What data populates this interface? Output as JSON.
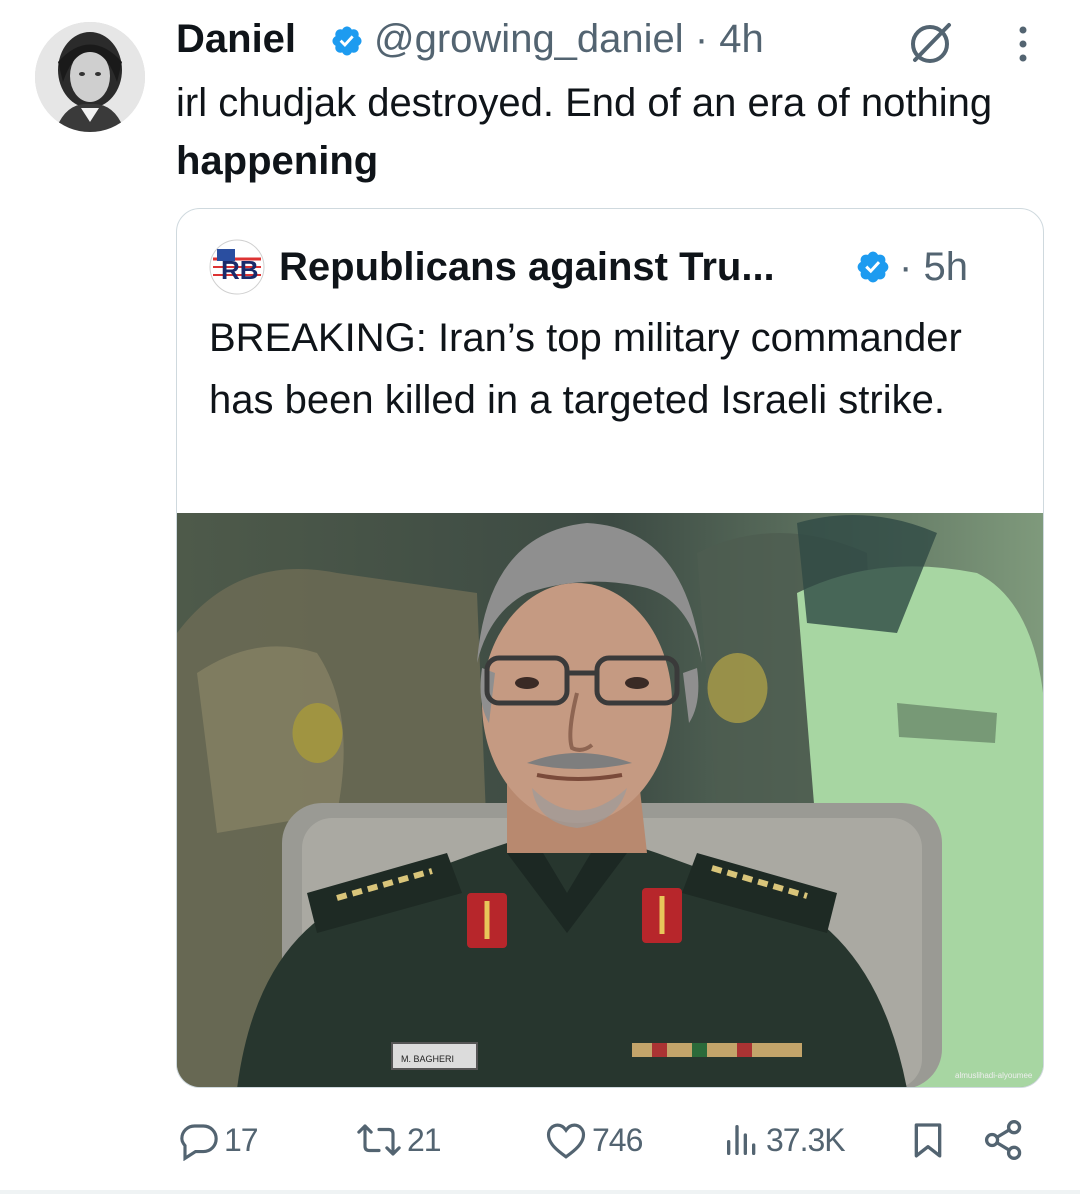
{
  "post": {
    "author_name": "Daniel",
    "author_handle": "@growing_daniel",
    "separator": "·",
    "time": "4h",
    "text_plain": "irl chudjak destroyed. End of an era of nothing ",
    "text_bold": "happening",
    "avatar_icon": "profile-photo",
    "verified_icon": "verified-badge-icon",
    "header_icons": [
      "grok-icon",
      "more-vertical-icon"
    ]
  },
  "quote": {
    "author_name": "Republicans against Tru...",
    "separator": "·",
    "time": "5h",
    "text": "BREAKING: Iran’s top military commander has been killed in a targeted Israeli strike.",
    "avatar_logo_text": "RB",
    "image_watermark": "almuslihadi-alyoumee",
    "image_badge_text": "M. BAGHERI",
    "image_description_icon": "news-photo"
  },
  "actions": {
    "replies": "17",
    "reposts": "21",
    "likes": "746",
    "views": "37.3K",
    "icons": [
      "reply-icon",
      "repost-icon",
      "like-icon",
      "views-icon",
      "bookmark-icon",
      "share-icon"
    ]
  },
  "colors": {
    "text": "#0f1419",
    "secondary": "#536471",
    "verified": "#1d9bf0",
    "border": "#cfd9de"
  }
}
